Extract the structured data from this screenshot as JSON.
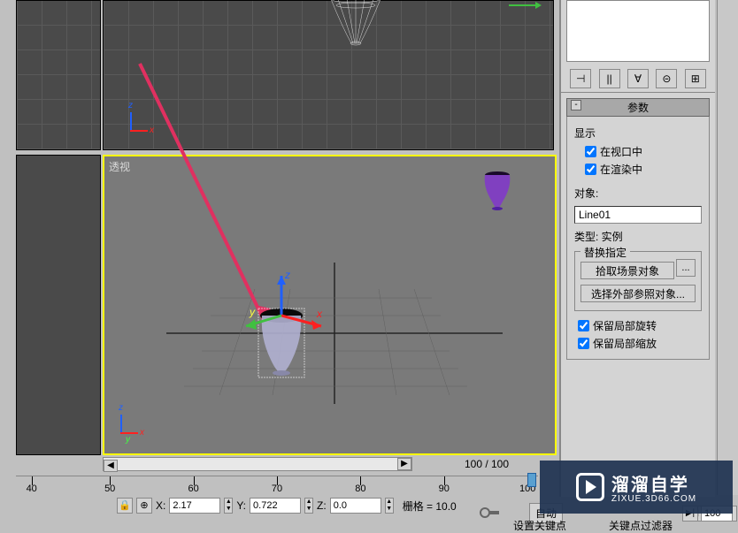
{
  "viewport": {
    "persp_label": "透视"
  },
  "timeline": {
    "frame_display": "100 / 100",
    "ticks": [
      40,
      50,
      60,
      70,
      80,
      90,
      100
    ]
  },
  "coords": {
    "x_label": "X:",
    "x_value": "2.17",
    "y_label": "Y:",
    "y_value": "0.722",
    "z_label": "Z:",
    "z_value": "0.0",
    "grid_label": "栅格 = 10.0"
  },
  "panel": {
    "rollout_title": "参数",
    "display_label": "显示",
    "in_viewport": "在视口中",
    "in_render": "在渲染中",
    "object_label": "对象:",
    "object_value": "Line01",
    "type_label": "类型: 实例",
    "replace_section": "替换指定",
    "pick_scene": "拾取场景对象",
    "pick_dots": "...",
    "select_external": "选择外部参照对象...",
    "keep_rotation": "保留局部旋转",
    "keep_scale": "保留局部缩放",
    "collapse_symbol": "-"
  },
  "bottom": {
    "auto_key": "自动",
    "set_keypoint": "设置关键点",
    "keypoint_filter": "关键点过滤器",
    "frame_num": "100"
  },
  "watermark": {
    "text": "溜溜自学",
    "url": "ZIXUE.3D66.COM"
  },
  "icons": {
    "pin": "⊣",
    "pipes": "||",
    "vee": "∀",
    "circle": "⊝",
    "grid": "⊞",
    "lock": "🔒",
    "crosshair": "⊕",
    "prev2": "|◀",
    "prev": "◀",
    "play": "▶",
    "next2": "▶|"
  }
}
